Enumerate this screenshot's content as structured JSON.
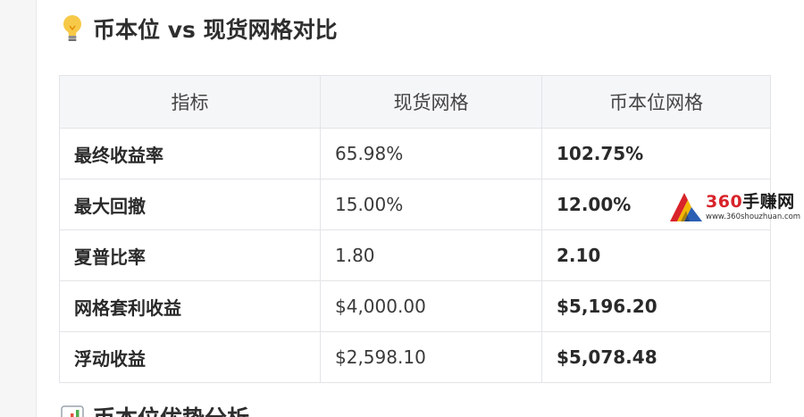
{
  "section": {
    "icon": "lightbulb-icon",
    "title": "币本位 vs 现货网格对比"
  },
  "table": {
    "headers": [
      "指标",
      "现货网格",
      "币本位网格"
    ],
    "rows": [
      {
        "metric": "最终收益率",
        "spot": "65.98%",
        "coin": "102.75%"
      },
      {
        "metric": "最大回撤",
        "spot": "15.00%",
        "coin": "12.00%"
      },
      {
        "metric": "夏普比率",
        "spot": "1.80",
        "coin": "2.10"
      },
      {
        "metric": "网格套利收益",
        "spot": "$4,000.00",
        "coin": "$5,196.20"
      },
      {
        "metric": "浮动收益",
        "spot": "$2,598.10",
        "coin": "$5,078.48"
      }
    ]
  },
  "watermark": {
    "brand_num": "360",
    "brand_text": "手赚网",
    "url": "www.360shouzhuan.com",
    "colors": {
      "red": "#d8232a",
      "yellow": "#f2b705",
      "blue": "#2b5fb4"
    }
  },
  "next_section": {
    "icon": "bar-chart-icon",
    "title": "币本位优势分析"
  }
}
